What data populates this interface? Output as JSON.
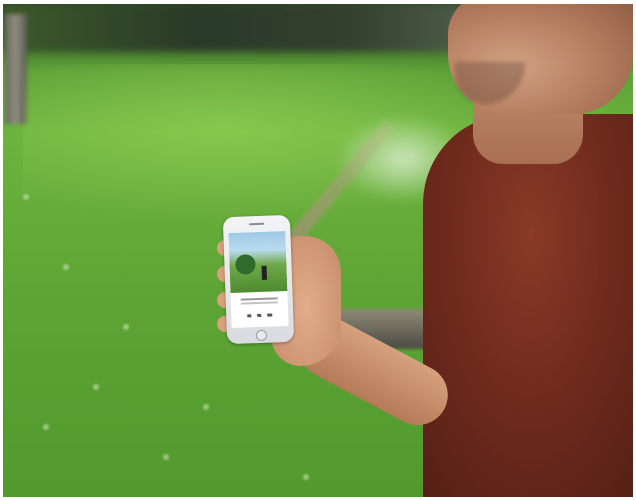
{
  "scene": {
    "subject": "person-holding-smartphone",
    "setting": "lawn-with-sprinklers"
  },
  "colors": {
    "grass": "#5fa535",
    "shirt": "#6e2a1c",
    "skin": "#c99476",
    "phone": "#e6e7ea"
  }
}
